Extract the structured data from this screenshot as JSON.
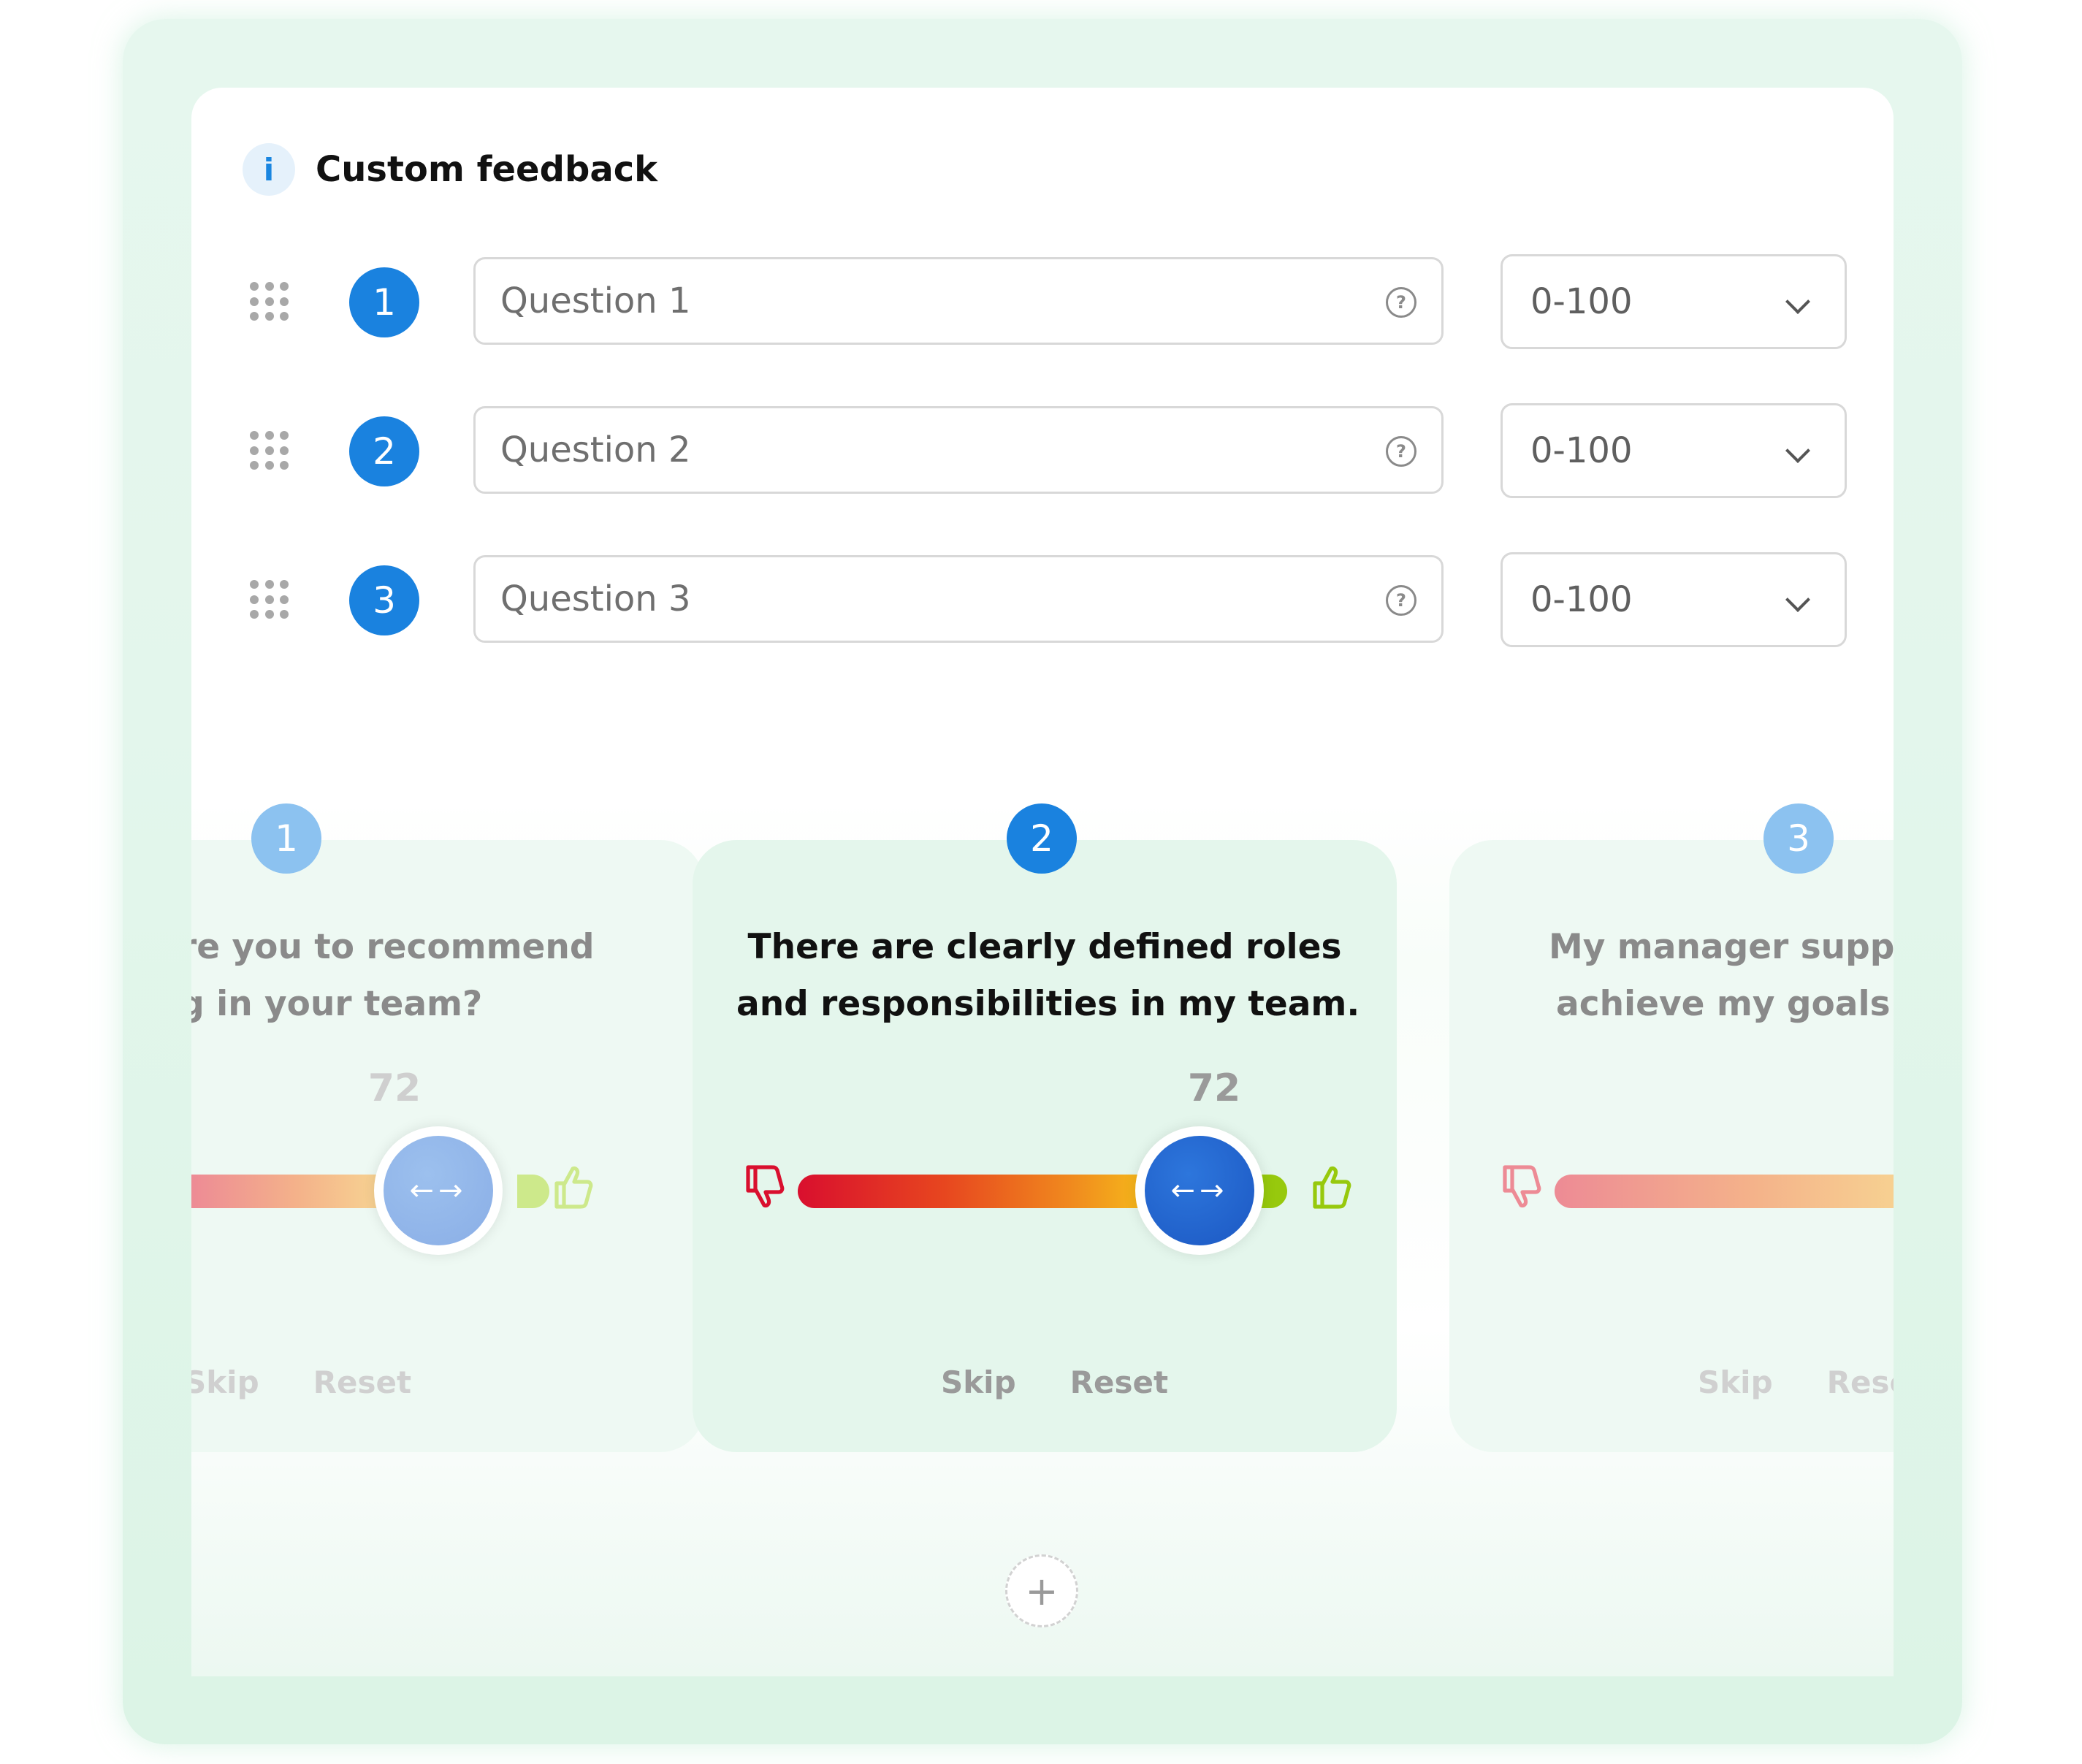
{
  "header": {
    "info_glyph": "i",
    "title": "Custom feedback"
  },
  "questions": [
    {
      "number": "1",
      "placeholder": "Question 1",
      "scale": "0-100"
    },
    {
      "number": "2",
      "placeholder": "Question 2",
      "scale": "0-100"
    },
    {
      "number": "3",
      "placeholder": "Question 3",
      "scale": "0-100"
    }
  ],
  "help_glyph": "?",
  "cards": [
    {
      "number": "1",
      "line1": "ıre you to recommend",
      "line2": "ıg in your team?",
      "value": "72",
      "skip": "Skip",
      "reset": "Reset"
    },
    {
      "number": "2",
      "line1": "There are clearly defined roles",
      "line2": "and responsibilities in my team.",
      "value": "72",
      "skip": "Skip",
      "reset": "Reset"
    },
    {
      "number": "3",
      "line1": "My manager suppo",
      "line2": "achieve my goals c",
      "skip": "Skip",
      "reset": "Reset"
    }
  ],
  "slider_glyph": "←→",
  "add_glyph": "+",
  "colors": {
    "accent": "#1a82df",
    "card_bg": "#e4f6ec",
    "thumb_down": "#d90f2e",
    "thumb_up": "#97c90d"
  },
  "icons": [
    "info-icon",
    "drag-handle-icon",
    "help-circle-icon",
    "chevron-down-icon",
    "thumbs-down-icon",
    "thumbs-up-icon",
    "slider-arrows-icon",
    "plus-icon"
  ]
}
